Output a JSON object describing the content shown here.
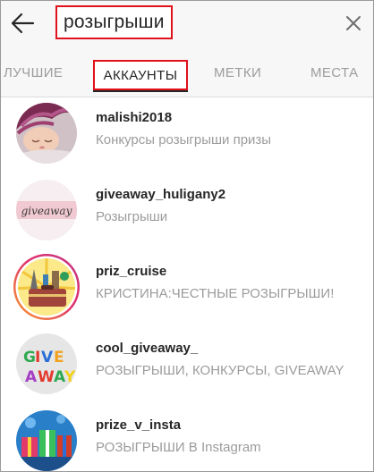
{
  "search": {
    "query": "розыгрыши",
    "back_icon": "arrow-left-icon",
    "clear_icon": "close-icon"
  },
  "tabs": [
    {
      "label": "ЛУЧШИЕ",
      "active": false
    },
    {
      "label": "АККАУНТЫ",
      "active": true
    },
    {
      "label": "МЕТКИ",
      "active": false
    },
    {
      "label": "МЕСТА",
      "active": false
    }
  ],
  "accounts": [
    {
      "username": "malishi2018",
      "subtitle": "Конкурсы розыгрыши призы",
      "avatar": "sleeping-baby-photo"
    },
    {
      "username": "giveaway_huligany2",
      "subtitle": "Розыгрыши",
      "avatar": "giveaway-script-logo",
      "avatar_text": "giveaway"
    },
    {
      "username": "priz_cruise",
      "subtitle": "КРИСТИНА:ЧЕСТНЫЕ РОЗЫГРЫШИ!",
      "avatar": "travel-suitcase-landmarks"
    },
    {
      "username": "cool_giveaway_",
      "subtitle": "РОЗЫГРЫШИ, КОНКУРСЫ, GIVEAWAY",
      "avatar": "giveaway-3d-letters",
      "avatar_text": "GIVE AWAY"
    },
    {
      "username": "prize_v_insta",
      "subtitle": "РОЗЫГРЫШИ В Instagram",
      "avatar": "gift-boxes-photo"
    }
  ],
  "colors": {
    "highlight_border": "#e0111b",
    "story_ring_gradient": [
      "#f9a12e",
      "#e1306c",
      "#c13584"
    ],
    "text_primary": "#262626",
    "text_secondary": "#9c9c9c"
  }
}
